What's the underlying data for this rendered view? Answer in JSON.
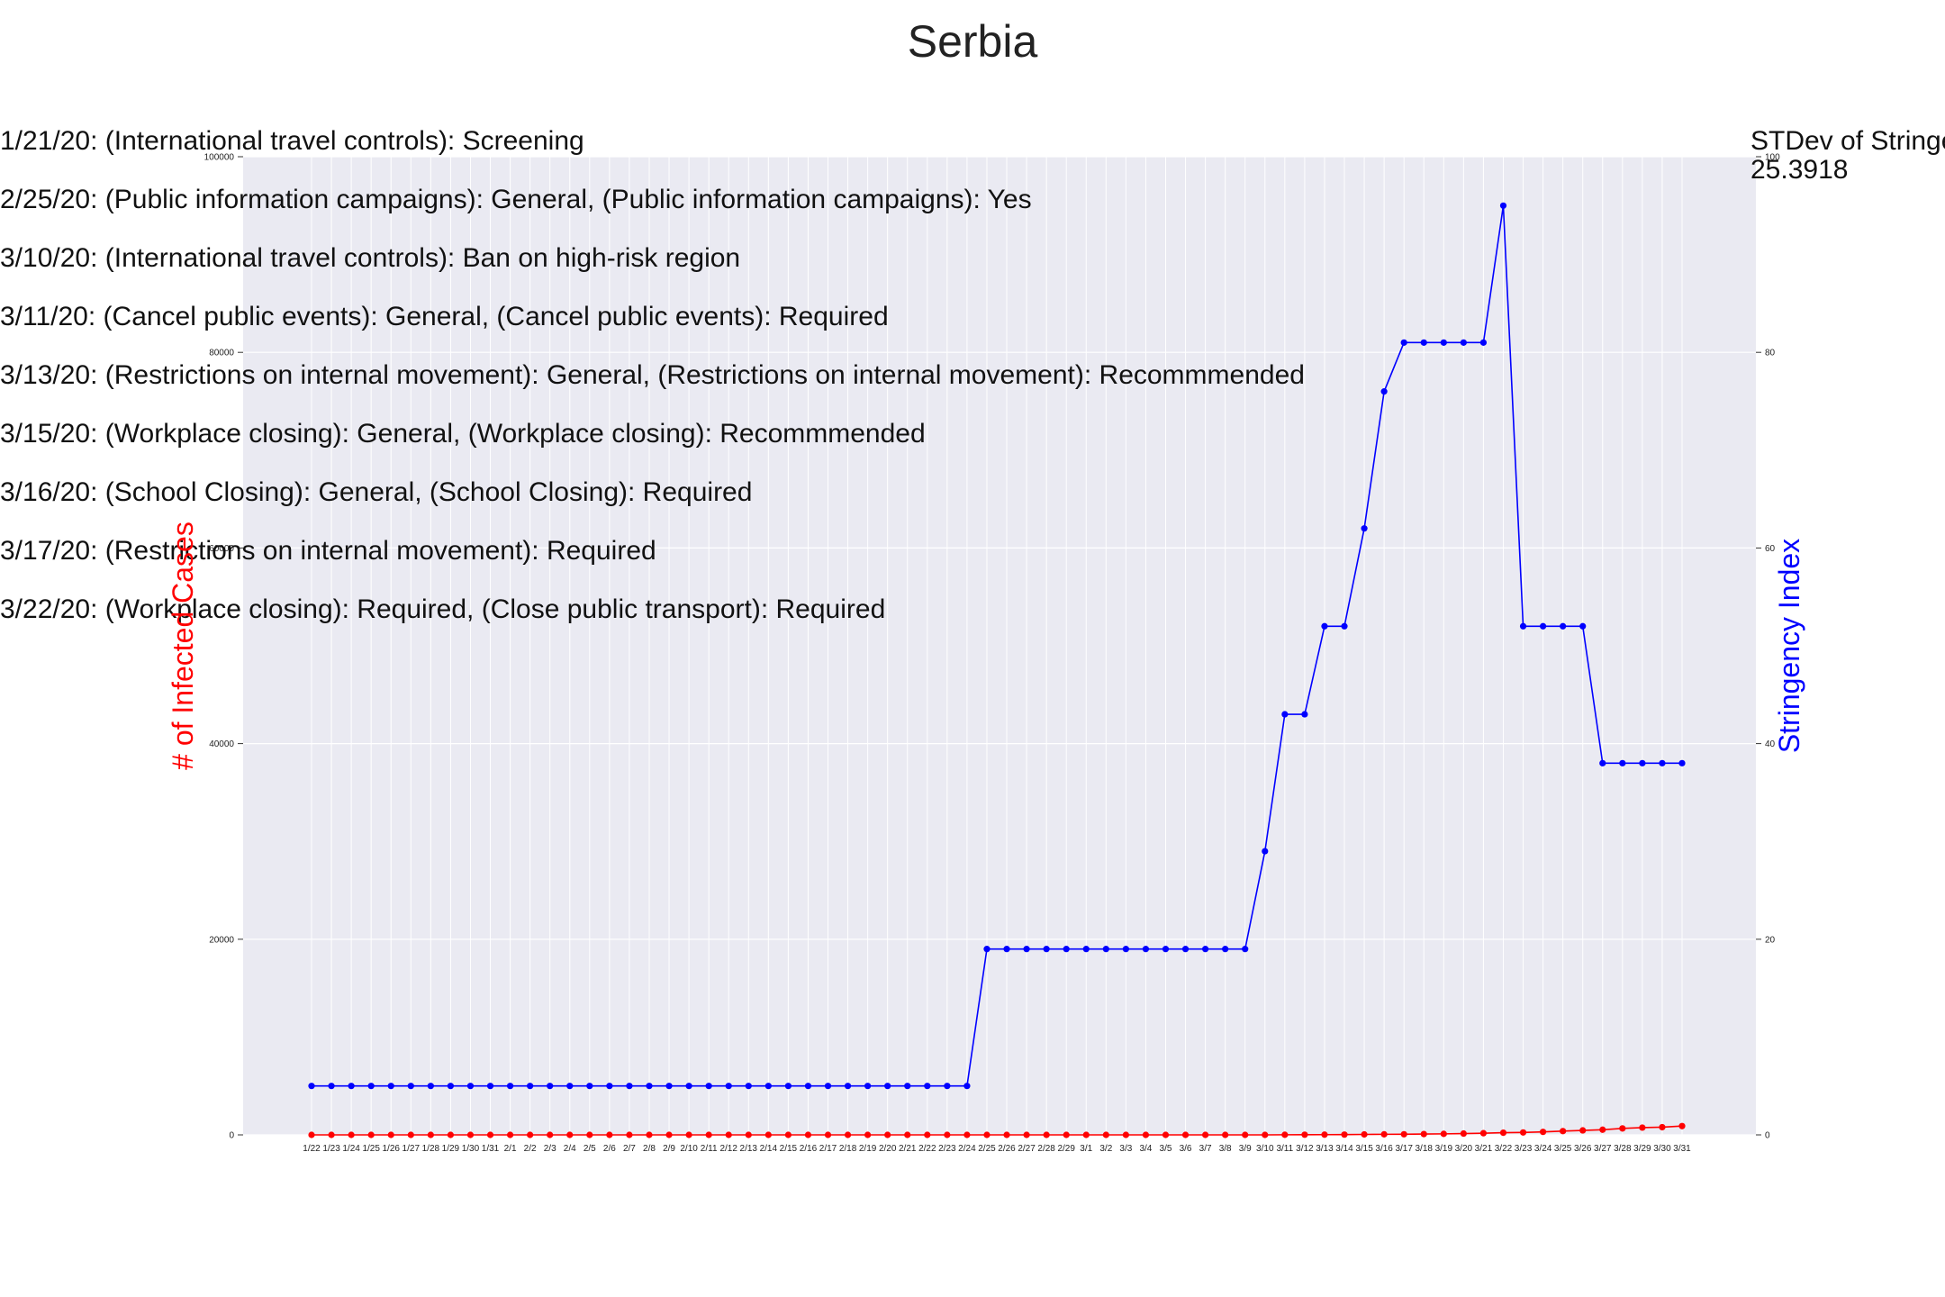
{
  "chart_data": {
    "type": "line",
    "title": "Serbia",
    "categories": [
      "1/22",
      "1/23",
      "1/24",
      "1/25",
      "1/26",
      "1/27",
      "1/28",
      "1/29",
      "1/30",
      "1/31",
      "2/1",
      "2/2",
      "2/3",
      "2/4",
      "2/5",
      "2/6",
      "2/7",
      "2/8",
      "2/9",
      "2/10",
      "2/11",
      "2/12",
      "2/13",
      "2/14",
      "2/15",
      "2/16",
      "2/17",
      "2/18",
      "2/19",
      "2/20",
      "2/21",
      "2/22",
      "2/23",
      "2/24",
      "2/25",
      "2/26",
      "2/27",
      "2/28",
      "2/29",
      "3/1",
      "3/2",
      "3/3",
      "3/4",
      "3/5",
      "3/6",
      "3/7",
      "3/8",
      "3/9",
      "3/10",
      "3/11",
      "3/12",
      "3/13",
      "3/14",
      "3/15",
      "3/16",
      "3/17",
      "3/18",
      "3/19",
      "3/20",
      "3/21",
      "3/22",
      "3/23",
      "3/24",
      "3/25",
      "3/26",
      "3/27",
      "3/28",
      "3/29",
      "3/30",
      "3/31"
    ],
    "y_left": {
      "label": "# of Infected Cases",
      "ylim": [
        0,
        100000
      ],
      "ticks": [
        0,
        20000,
        40000,
        60000,
        80000,
        100000
      ],
      "color": "#ff0000"
    },
    "y_right": {
      "label": "Stringency Index",
      "ylim": [
        0,
        100
      ],
      "ticks": [
        0,
        20,
        40,
        60,
        80,
        100
      ],
      "color": "#0000ff"
    },
    "series": [
      {
        "axis": "left",
        "color": "#ff0000",
        "values": [
          0,
          0,
          0,
          0,
          0,
          0,
          0,
          0,
          0,
          0,
          0,
          0,
          0,
          0,
          0,
          0,
          0,
          0,
          0,
          0,
          0,
          0,
          0,
          0,
          0,
          0,
          0,
          0,
          0,
          0,
          0,
          0,
          0,
          0,
          0,
          0,
          0,
          0,
          0,
          0,
          0,
          0,
          0,
          0,
          0,
          0,
          0,
          0,
          1,
          12,
          19,
          24,
          31,
          46,
          57,
          65,
          83,
          103,
          135,
          171,
          222,
          249,
          303,
          384,
          457,
          528,
          659,
          741,
          785,
          900
        ]
      },
      {
        "axis": "right",
        "color": "#0000ff",
        "values": [
          5,
          5,
          5,
          5,
          5,
          5,
          5,
          5,
          5,
          5,
          5,
          5,
          5,
          5,
          5,
          5,
          5,
          5,
          5,
          5,
          5,
          5,
          5,
          5,
          5,
          5,
          5,
          5,
          5,
          5,
          5,
          5,
          5,
          5,
          19,
          19,
          19,
          19,
          19,
          19,
          19,
          19,
          19,
          19,
          19,
          19,
          19,
          19,
          29,
          43,
          43,
          52,
          52,
          62,
          76,
          81,
          81,
          81,
          81,
          81,
          95,
          52,
          52,
          52,
          52,
          38,
          38,
          38,
          38,
          38
        ]
      }
    ],
    "grid": true,
    "annotations": [
      "1/21/20: (International travel controls): Screening",
      "2/25/20: (Public information campaigns): General, (Public information campaigns): Yes",
      "3/10/20: (International travel controls): Ban on high-risk region",
      "3/11/20: (Cancel public events): General, (Cancel public events): Required",
      "3/13/20: (Restrictions on internal movement): General, (Restrictions on internal movement): Recommmended",
      "3/15/20: (Workplace closing): General, (Workplace closing): Recommmended",
      "3/16/20: (School Closing): General, (School Closing): Required",
      "3/17/20: (Restrictions on internal movement): Required",
      "3/22/20: (Workplace closing): Required, (Close public transport): Required"
    ],
    "stdev_label": "STDev of Stringency Index:",
    "stdev_value": "25.3918"
  }
}
